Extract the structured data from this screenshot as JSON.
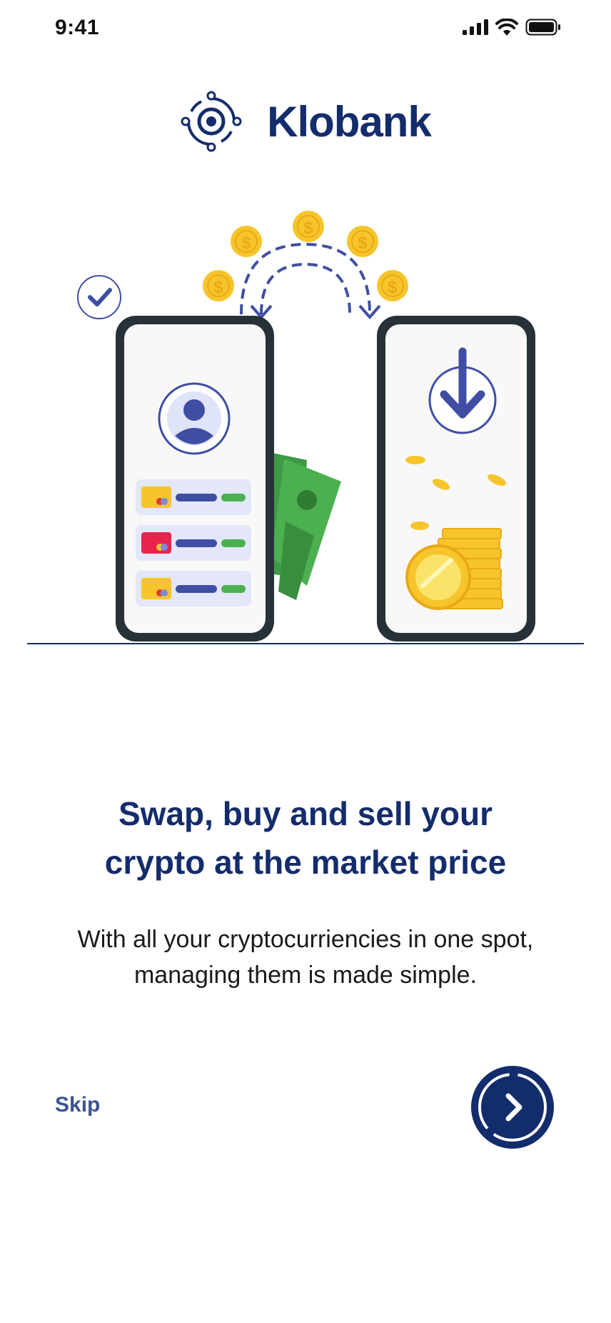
{
  "status_bar": {
    "time": "9:41",
    "icons": [
      "signal-icon",
      "wifi-icon",
      "battery-icon"
    ]
  },
  "brand": {
    "name": "Klobank",
    "logo_icon": "orbit-logo-icon"
  },
  "onboarding": {
    "headline_line1": "Swap, buy and sell your",
    "headline_line2": "crypto at the market price",
    "subtitle_line1": "With all your cryptocurriencies in one spot,",
    "subtitle_line2": "managing them is made simple."
  },
  "actions": {
    "skip_label": "Skip",
    "next_icon": "chevron-right-icon"
  },
  "illustration": {
    "coin_symbol": "$"
  },
  "colors": {
    "primary": "#132c6b",
    "accent_blue": "#3f4ea3",
    "coin": "#f7c52b",
    "green": "#4caf50",
    "phone_frame": "#263238"
  }
}
